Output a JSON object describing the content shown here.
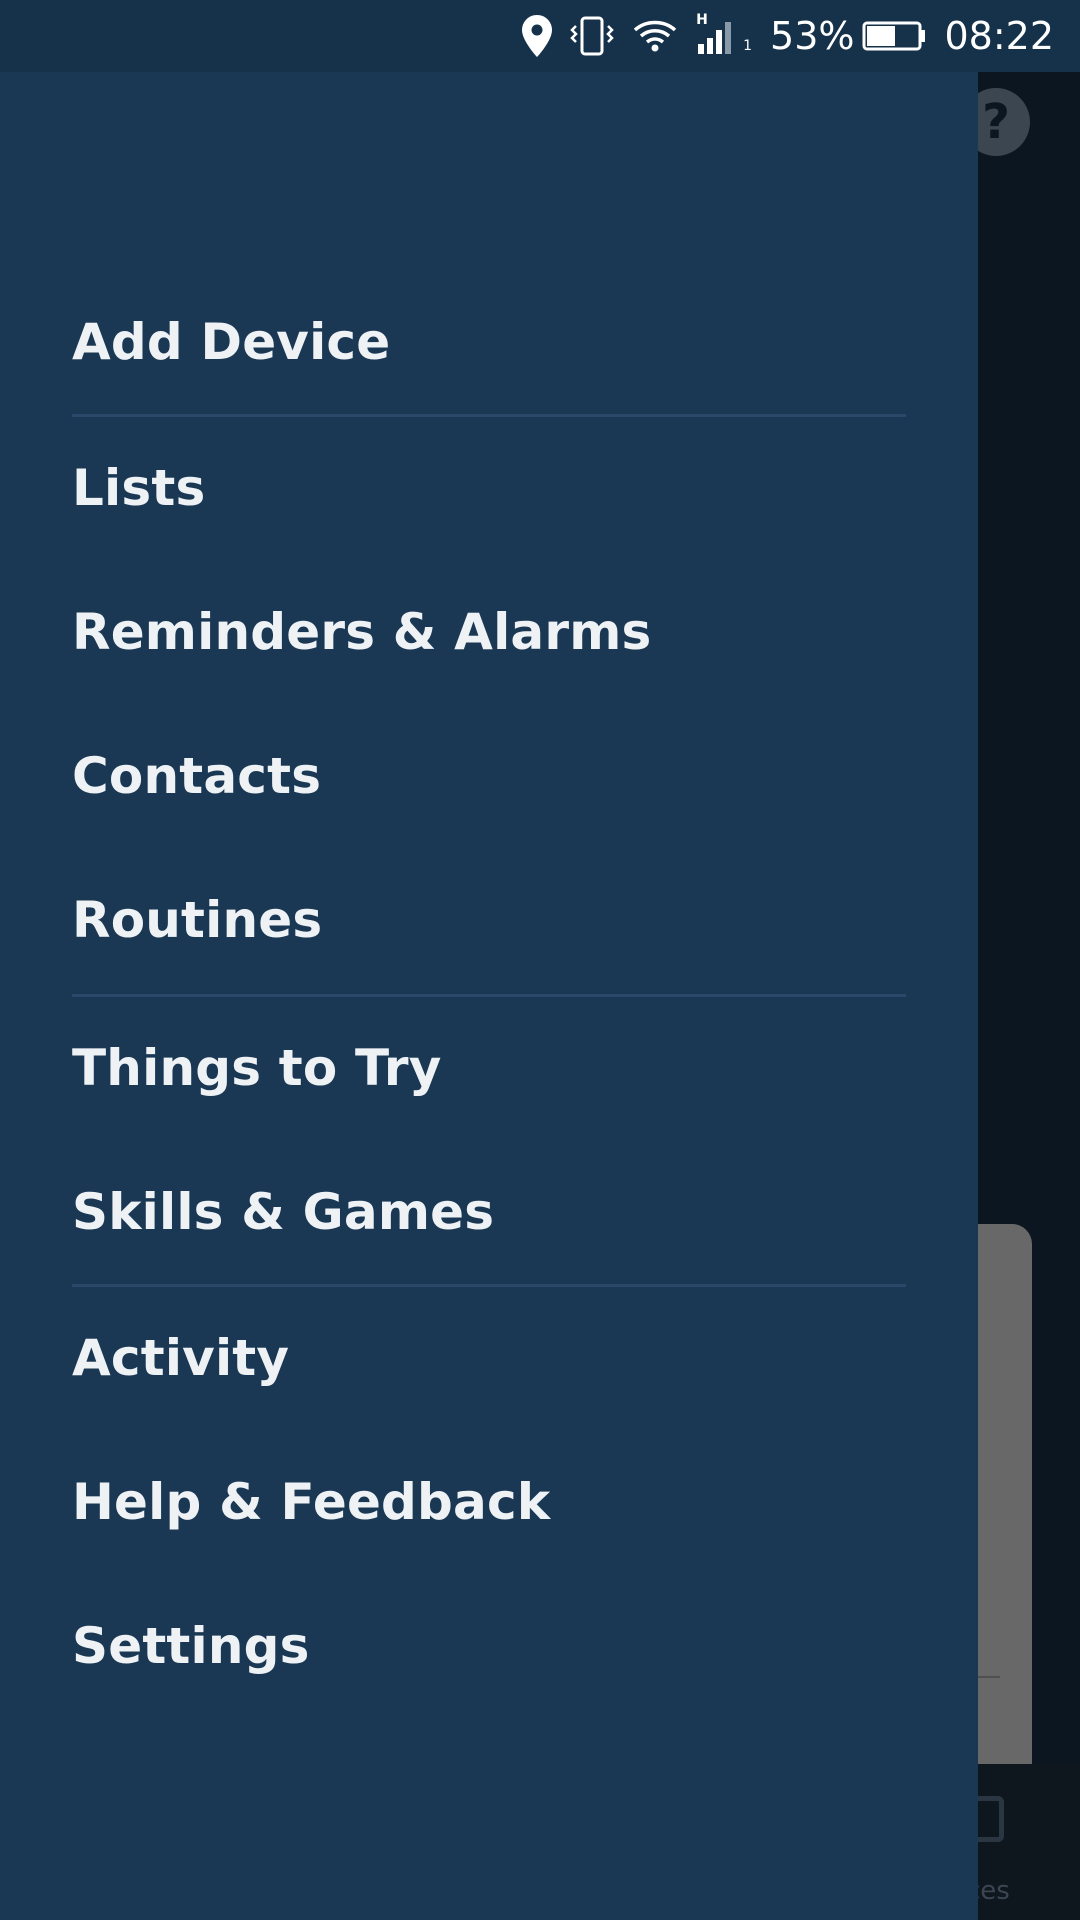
{
  "status_bar": {
    "battery_percent": "53%",
    "time": "08:22",
    "network_type": "H",
    "sim_slot": "1",
    "icons": [
      "location-icon",
      "vibrate-icon",
      "wifi-icon",
      "signal-icon",
      "battery-icon"
    ]
  },
  "drawer": {
    "menu": [
      {
        "label": "Add Device"
      },
      {
        "label": "Lists"
      },
      {
        "label": "Reminders & Alarms"
      },
      {
        "label": "Contacts"
      },
      {
        "label": "Routines"
      },
      {
        "label": "Things to Try"
      },
      {
        "label": "Skills & Games"
      },
      {
        "label": "Activity"
      },
      {
        "label": "Help & Feedback"
      },
      {
        "label": "Settings"
      }
    ]
  },
  "background_app": {
    "help_icon_glyph": "?",
    "bottom_nav_partial_label": "ces"
  },
  "colors": {
    "drawer_bg": "#1a3854",
    "status_bar_bg": "#15324a",
    "text": "#eef2f5",
    "divider": "#29486a"
  }
}
